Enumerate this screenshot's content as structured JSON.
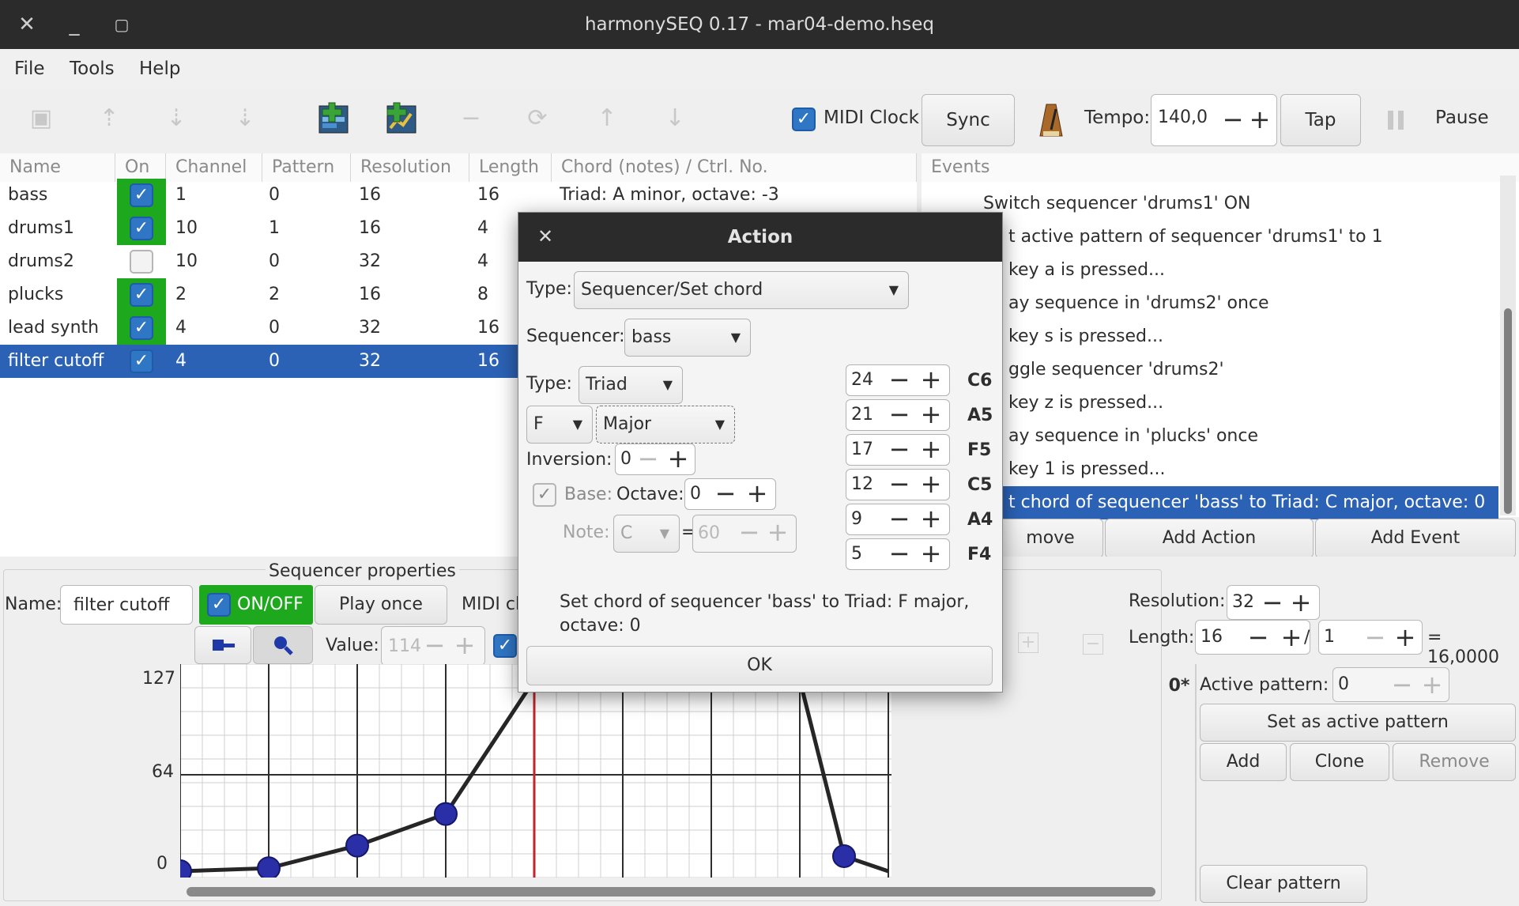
{
  "window": {
    "title": "harmonySEQ 0.17 - mar04-demo.hseq"
  },
  "menu": {
    "file": "File",
    "tools": "Tools",
    "help": "Help"
  },
  "toolbar": {
    "midi_clock": "MIDI Clock",
    "sync": "Sync",
    "tempo_label": "Tempo:",
    "tempo_value": "140,0",
    "tap": "Tap",
    "pause": "Pause"
  },
  "seq_table": {
    "headers": [
      "Name",
      "On",
      "Channel",
      "Pattern",
      "Resolution",
      "Length",
      "Chord (notes) / Ctrl. No."
    ],
    "rows": [
      {
        "name": "bass",
        "on": true,
        "channel": "1",
        "pattern": "0",
        "resolution": "16",
        "length": "16",
        "chord": "Triad: A minor, octave: -3"
      },
      {
        "name": "drums1",
        "on": true,
        "channel": "10",
        "pattern": "1",
        "resolution": "16",
        "length": "4",
        "chord": ""
      },
      {
        "name": "drums2",
        "on": false,
        "channel": "10",
        "pattern": "0",
        "resolution": "32",
        "length": "4",
        "chord": ""
      },
      {
        "name": "plucks",
        "on": true,
        "channel": "2",
        "pattern": "2",
        "resolution": "16",
        "length": "8",
        "chord": ""
      },
      {
        "name": "lead synth",
        "on": true,
        "channel": "4",
        "pattern": "0",
        "resolution": "32",
        "length": "16",
        "chord": ""
      },
      {
        "name": "filter cutoff",
        "on": true,
        "channel": "4",
        "pattern": "0",
        "resolution": "32",
        "length": "16",
        "chord": ""
      }
    ]
  },
  "events": {
    "header": "Events",
    "items": [
      "Switch sequencer 'drums1' ON",
      "t active pattern of sequencer 'drums1' to 1",
      "key a is pressed...",
      "ay sequence in 'drums2' once",
      "key s is pressed...",
      "ggle sequencer 'drums2'",
      "key z is pressed...",
      "ay sequence in 'plucks' once",
      "key 1 is pressed...",
      "t chord of sequencer 'bass' to Triad: C major, octave: 0"
    ],
    "remove": "move",
    "add_action": "Add Action",
    "add_event": "Add Event"
  },
  "props": {
    "title": "Sequencer properties",
    "name_label": "Name:",
    "name_value": "filter cutoff",
    "onoff": "ON/OFF",
    "play_once": "Play once",
    "midi_trunc": "MIDI cl",
    "value_label": "Value:",
    "value": "114",
    "y_labels": [
      "127",
      "64",
      "0"
    ],
    "resolution_label": "Resolution:",
    "resolution_value": "32",
    "length_label": "Length:",
    "length_value": "16",
    "length_div": "/",
    "length_den": "1",
    "length_result": "= 16,0000",
    "pattern_tab": "0*",
    "active_pattern_label": "Active pattern:",
    "active_pattern_value": "0",
    "set_active": "Set as active pattern",
    "add": "Add",
    "clone": "Clone",
    "remove": "Remove",
    "clear": "Clear pattern"
  },
  "chart_data": {
    "type": "line",
    "ylim": [
      0,
      127
    ],
    "x": [
      0,
      2,
      4,
      6,
      8,
      14,
      15,
      16
    ],
    "values": [
      0,
      2,
      17,
      38,
      127,
      127,
      10,
      0
    ],
    "playhead": 8
  },
  "dialog": {
    "title": "Action",
    "type_label": "Type:",
    "type_value": "Sequencer/Set chord",
    "sequencer_label": "Sequencer:",
    "sequencer_value": "bass",
    "chord_type_label": "Type:",
    "chord_type_value": "Triad",
    "root_value": "F",
    "mode_value": "Major",
    "inversion_label": "Inversion:",
    "inversion_value": "0",
    "base_label": "Base:",
    "octave_label": "Octave:",
    "octave_value": "0",
    "note_label": "Note:",
    "note_value": "C",
    "eq": "=",
    "note_num": "60",
    "notes": [
      {
        "num": "24",
        "name": "C6"
      },
      {
        "num": "21",
        "name": "A5"
      },
      {
        "num": "17",
        "name": "F5"
      },
      {
        "num": "12",
        "name": "C5"
      },
      {
        "num": "9",
        "name": "A4"
      },
      {
        "num": "5",
        "name": "F4"
      }
    ],
    "summary": "Set chord of sequencer 'bass' to Triad: F major, octave: 0",
    "ok": "OK"
  }
}
